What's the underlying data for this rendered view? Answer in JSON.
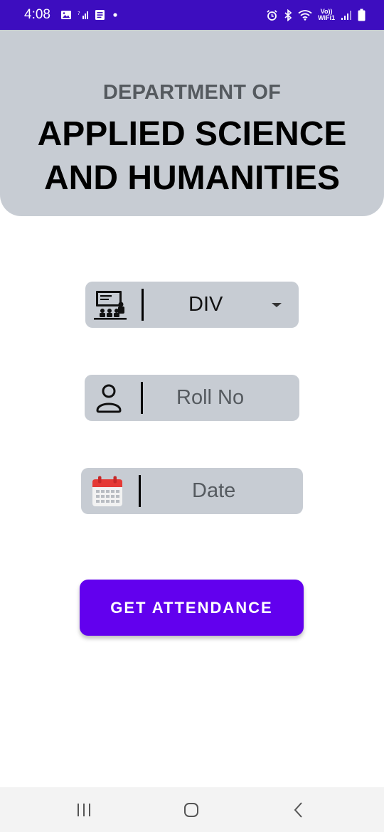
{
  "status_bar": {
    "time": "4:08",
    "wifi_label_top": "Vo))",
    "wifi_label_bottom": "WiFi1"
  },
  "header": {
    "subtitle": "DEPARTMENT OF",
    "title_line1": "APPLIED SCIENCE",
    "title_line2": "AND HUMANITIES"
  },
  "form": {
    "division": {
      "value": "DIV",
      "icon": "classroom-icon"
    },
    "roll_no": {
      "placeholder": "Roll No",
      "icon": "person-icon"
    },
    "date": {
      "placeholder": "Date",
      "icon": "calendar-icon"
    }
  },
  "submit_label": "GET ATTENDANCE",
  "colors": {
    "status_bar": "#3d0dbf",
    "header_bg": "#c7ccd3",
    "button": "#6200ee"
  }
}
